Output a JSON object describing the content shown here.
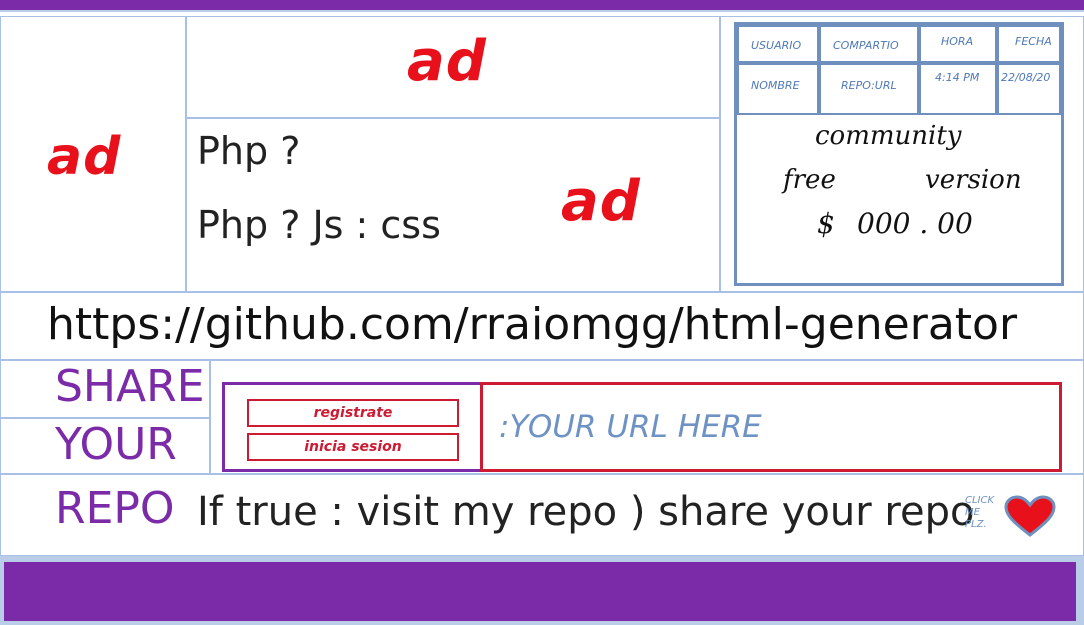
{
  "ads": {
    "left": "ad",
    "top": "ad",
    "middle": "ad"
  },
  "header": {
    "line1": "Php ?",
    "line2": "Php ? Js : css"
  },
  "nav": {
    "usuario": "USUARIO",
    "compartio": "COMPARTIO",
    "hora": "HORA",
    "fecha": "FECHA",
    "nombre": "NOMBRE",
    "repo_url": "REPO:URL",
    "time": "4:14 PM",
    "date": "22/08/20"
  },
  "plan": {
    "title": "community",
    "free": "free",
    "version": "version",
    "currency": "$",
    "price": "000 . 00"
  },
  "repo_link": "https://github.com/rraiomgg/html-generator",
  "share": {
    "word1": "SHARE",
    "word2": "YOUR",
    "word3": "REPO",
    "register_label": "registrate",
    "login_label": "inicia sesion",
    "url_placeholder": ":YOUR URL HERE",
    "tagline": "If true : visit my repo ) share your repo",
    "click_line1": "CLICK",
    "click_line2": "ME",
    "click_line3": "PLZ."
  },
  "colors": {
    "purple": "#7b2aa8",
    "red": "#cc1b33",
    "blue_border": "#6f8fbf",
    "light_blue": "#b9cce8"
  },
  "icons": {
    "heart": "heart-icon"
  }
}
